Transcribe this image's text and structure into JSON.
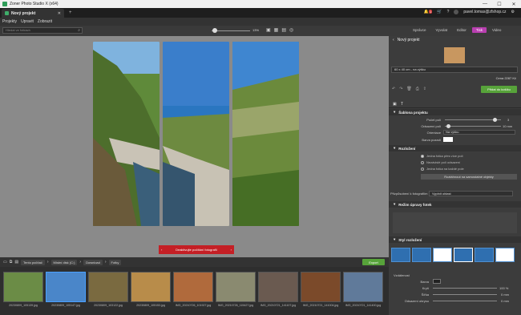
{
  "titlebar": {
    "title": "Zoner Photo Studio X (x64)",
    "minimize": "—",
    "maximize": "☐",
    "close": "✕"
  },
  "tabs": {
    "doc_tab_label": "Nový projekt",
    "close": "✕",
    "new_tab": "+"
  },
  "account": {
    "email": "pavel.tomas@zfshop.cz",
    "badge": "1"
  },
  "menu": [
    "Projekty",
    "Upravit",
    "Zobrazit"
  ],
  "toolbar": {
    "search_placeholder": "Hledat ve fotkách",
    "zoom_value": "13%"
  },
  "modes": [
    "Správce",
    "Vyvolat",
    "Editor",
    "Tisk",
    "Video"
  ],
  "active_mode": "Tisk",
  "canvas": {
    "deselect_label": "Deaktivujte počítání fotografií"
  },
  "rightpanel": {
    "project_name": "Nový projekt",
    "product": "60 x 40 cm - na výšku",
    "price": "Cena 2287 Kč",
    "add_to_cart": "Přidat do košíku",
    "template_section": "Šablona projektu",
    "props": [
      {
        "label": "Počet polí",
        "value": "3"
      },
      {
        "label": "Odsazení polí",
        "value": "10 mm"
      },
      {
        "label": "Orientace",
        "value": "Na výšku"
      },
      {
        "label": "Barva pozadí",
        "value": ""
      }
    ],
    "layout_section": "Rozložení",
    "radios": [
      "Jedna fotka přes více polí",
      "Nezávislé polí odsazení",
      "Jedna fotka na každé pole"
    ],
    "stretch_label": "Roztáhnout na samostatné objekty",
    "placement_label": "Přizpůsobení k fotografiím",
    "placement_value": "Vyplnit oblast",
    "edit_mode_section": "Režim úpravy fotek",
    "style_section": "Styl rozložení",
    "bottom_props": [
      {
        "label": "Barva",
        "value": ""
      },
      {
        "label": "Krytí",
        "value": "100 %"
      },
      {
        "label": "Šířka",
        "value": "0 mm"
      },
      {
        "label": "Odsazení obrysu",
        "value": "0 mm"
      }
    ],
    "vzdalenost": "Vzdálenost"
  },
  "bottombar": {
    "crumbs": [
      "Tento počítač",
      "Místní disk (C:)",
      "Download",
      "Fotky"
    ],
    "export": "Export"
  },
  "filmstrip": [
    {
      "name": "20230809_105139.jpg",
      "color": "#6b8c46"
    },
    {
      "name": "20230809_105147.jpg",
      "color": "#4a86c9"
    },
    {
      "name": "20230809_103122.jpg",
      "color": "#7a6a40"
    },
    {
      "name": "20230809_105153.jpg",
      "color": "#b88c4a"
    },
    {
      "name": "IMG_20210726_101927.jpg",
      "color": "#b06a3c"
    },
    {
      "name": "IMG_20210726_115427.jpg",
      "color": "#8a8a70"
    },
    {
      "name": "IMG_20210721_141107.jpg",
      "color": "#6a5a50"
    },
    {
      "name": "IMG_20210721_141004.jpg",
      "color": "#7b4a2a"
    },
    {
      "name": "IMG_20210721_141400.jpg",
      "color": "#607a9a"
    }
  ],
  "colors": {
    "accent": "#b93fb0",
    "green": "#57a33a",
    "red": "#c41f25"
  }
}
